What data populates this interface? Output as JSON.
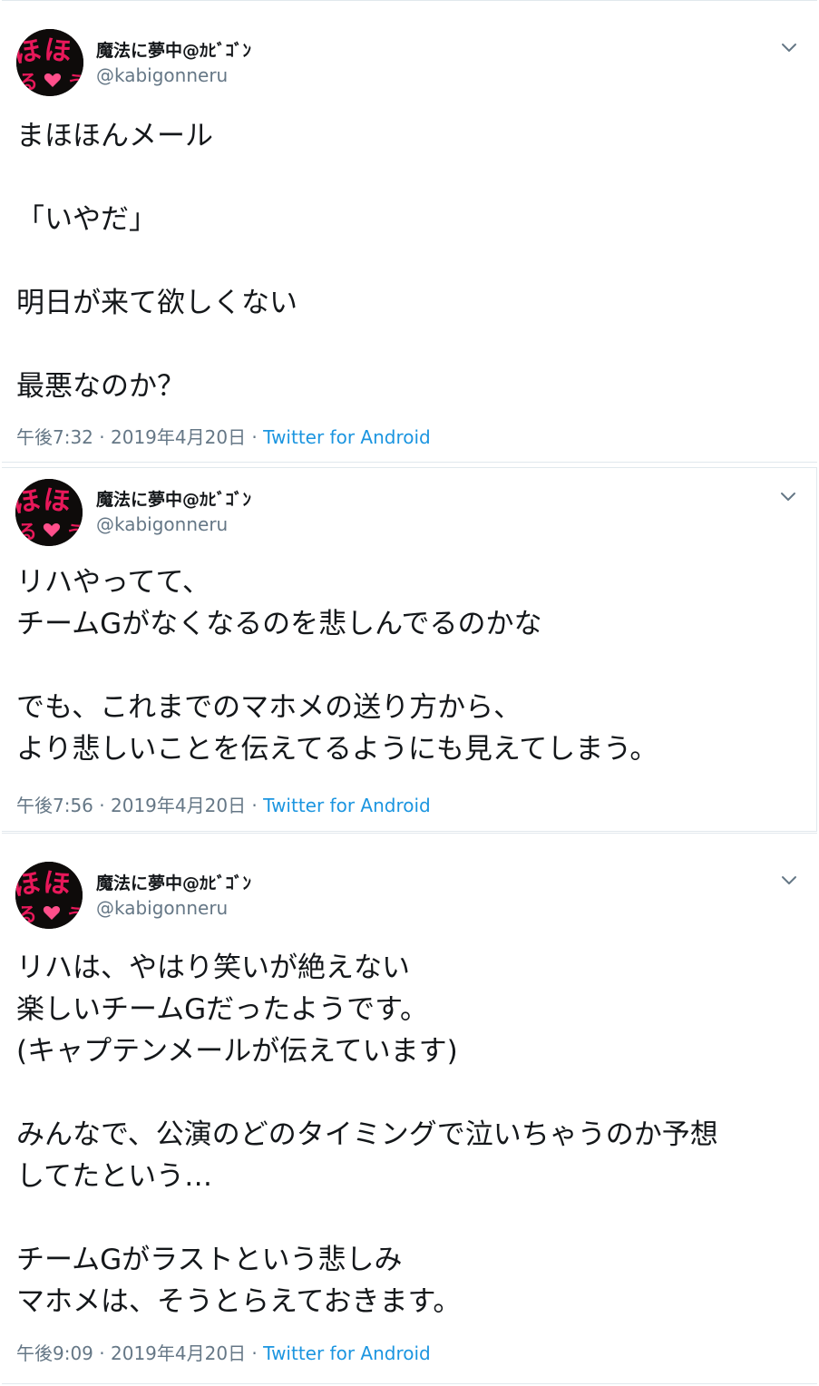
{
  "tweets": [
    {
      "display_name": "魔法に夢中@ｶﾋﾞｺﾞﾝ",
      "handle": "@kabigonneru",
      "text": "まほほんメール\n\n「いやだ」\n\n明日が来て欲しくない\n\n最悪なのか？",
      "time": "午後7:32",
      "date": "2019年4月20日",
      "source": "Twitter for Android"
    },
    {
      "display_name": "魔法に夢中@ｶﾋﾞｺﾞﾝ",
      "handle": "@kabigonneru",
      "text": "リハやってて、\nチームGがなくなるのを悲しんでるのかな\n\nでも、これまでのマホメの送り方から、\nより悲しいことを伝えてるようにも見えてしまう。",
      "time": "午後7:56",
      "date": "2019年4月20日",
      "source": "Twitter for Android"
    },
    {
      "display_name": "魔法に夢中@ｶﾋﾞｺﾞﾝ",
      "handle": "@kabigonneru",
      "text": "リハは、やはり笑いが絶えない\n楽しいチームGだったようです。\n(キャプテンメールが伝えています)\n\nみんなで、公演のどのタイミングで泣いちゃうのか予想\nしてたという…\n\nチームGがラストという悲しみ\nマホメは、そうとらえておきます。",
      "time": "午後9:09",
      "date": "2019年4月20日",
      "source": "Twitter for Android"
    }
  ],
  "separator": " · ",
  "icons": {
    "avatar": "avatar-image",
    "menu": "chevron-down-icon"
  },
  "colors": {
    "text": "#14171a",
    "secondary": "#657786",
    "link": "#1b95e0",
    "avatar_text": "#e8185a",
    "border": "#e1e8ed"
  }
}
